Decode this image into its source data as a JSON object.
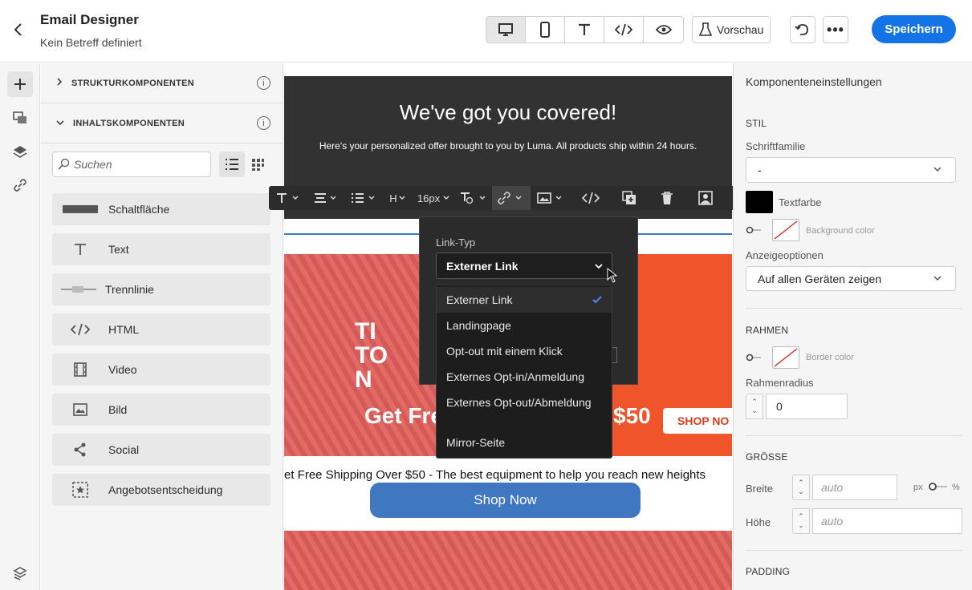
{
  "header": {
    "title": "Email Designer",
    "subtitle": "Kein Betreff definiert",
    "preview_label": "Vorschau",
    "save_label": "Speichern"
  },
  "left_panel": {
    "structure_title": "STRUKTURKOMPONENTEN",
    "content_title": "INHALTSKOMPONENTEN",
    "search_placeholder": "Suchen",
    "components": [
      {
        "label": "Schaltfläche",
        "icon": "button-icon"
      },
      {
        "label": "Text",
        "icon": "text-icon"
      },
      {
        "label": "Trennlinie",
        "icon": "divider-icon"
      },
      {
        "label": "HTML",
        "icon": "code-icon"
      },
      {
        "label": "Video",
        "icon": "video-icon"
      },
      {
        "label": "Bild",
        "icon": "image-icon"
      },
      {
        "label": "Social",
        "icon": "share-icon"
      },
      {
        "label": "Angebotsentscheidung",
        "icon": "offer-icon"
      }
    ]
  },
  "canvas": {
    "hero_title": "We've got you covered!",
    "hero_text": "Here's your personalized offer brought to you by Luma. All products ship within 24 hours.",
    "banner_big_left": "Get Fre",
    "banner_big_right": "$50",
    "banner_overlay": "TI\nTO\nN",
    "banner_shop": "SHOP NO",
    "ship_text": "et Free Shipping Over $50 - The best equipment to help you reach new heights",
    "shop_button": "Shop Now"
  },
  "toolbar": {
    "heading_label": "H",
    "font_size": "16px"
  },
  "link_popup": {
    "label": "Link-Typ",
    "selected": "Externer Link",
    "options": [
      "Externer Link",
      "Landingpage",
      "Opt-out mit einem Klick",
      "Externes Opt-in/Anmeldung",
      "Externes Opt-out/Abmeldung",
      "Mirror-Seite"
    ]
  },
  "right_panel": {
    "title": "Komponenteneinstellungen",
    "style_section": "STIL",
    "font_family_label": "Schriftfamilie",
    "font_family_value": "-",
    "text_color_label": "Textfarbe",
    "background_color_label": "Background color",
    "display_options_label": "Anzeigeoptionen",
    "display_options_value": "Auf allen Geräten zeigen",
    "border_section": "RAHMEN",
    "border_color_label": "Border color",
    "border_radius_label": "Rahmenradius",
    "border_radius_value": "0",
    "size_section": "GRÖSSE",
    "width_label": "Breite",
    "width_placeholder": "auto",
    "unit_px": "px",
    "unit_pct": "%",
    "height_label": "Höhe",
    "height_placeholder": "auto",
    "padding_section": "PADDING"
  },
  "colors": {
    "accent": "#1473e6",
    "hero_bg": "#323232",
    "banner_orange": "#f0542b",
    "shop_button": "#3f78c0",
    "text_color_swatch": "#000000"
  }
}
